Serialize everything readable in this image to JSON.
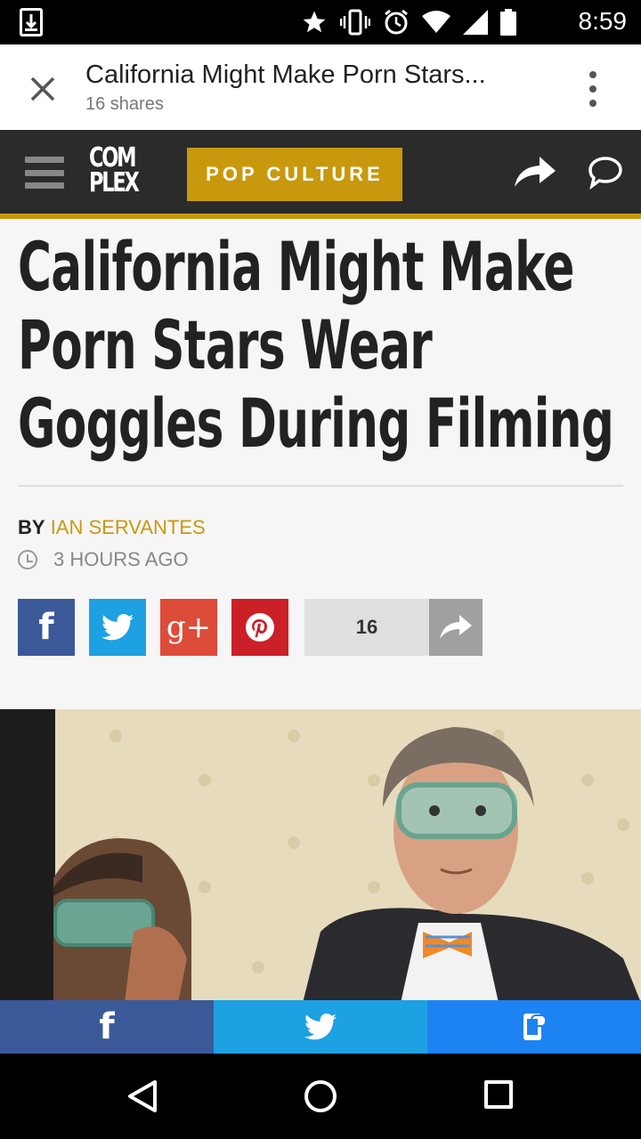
{
  "status_bar": {
    "time": "8:59",
    "icons": [
      "download-icon",
      "star-icon",
      "vibrate-icon",
      "alarm-icon",
      "wifi-icon",
      "signal-icon",
      "battery-icon"
    ]
  },
  "tab": {
    "title": "California Might Make Porn Stars...",
    "subtitle": "16 shares"
  },
  "site_header": {
    "logo_line1": "COM",
    "logo_line2": "PLEX",
    "section": "POP CULTURE"
  },
  "article": {
    "headline": "California Might Make Porn Stars Wear Goggles During Filming",
    "by_label": "BY",
    "author": "IAN SERVANTES",
    "time_ago": "3 HOURS AGO",
    "share_count": "16"
  },
  "colors": {
    "accent": "#c8990c",
    "facebook": "#3b5998",
    "twitter": "#1da1e2",
    "googleplus": "#dd4b39",
    "pinterest": "#cb2027",
    "sms": "#1d82f2"
  },
  "social_buttons": {
    "facebook": "f",
    "googleplus": "g+"
  },
  "bottom_share": {
    "facebook": "f"
  },
  "navbar": [
    "back-icon",
    "home-icon",
    "recents-icon"
  ]
}
